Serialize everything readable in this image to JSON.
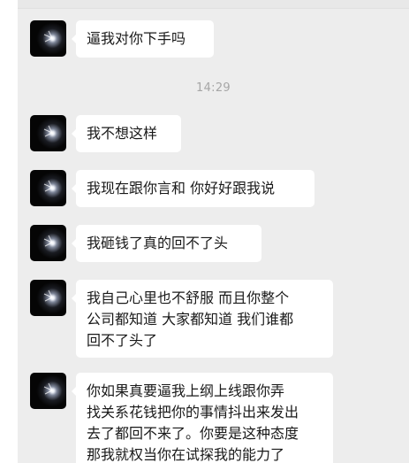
{
  "messages": [
    {
      "id": "m1",
      "lines": [
        "逼我对你下手吗"
      ]
    },
    {
      "id": "m2",
      "lines": [
        "我不想这样"
      ]
    },
    {
      "id": "m3",
      "lines": [
        "我现在跟你言和 你好好跟我说"
      ]
    },
    {
      "id": "m4",
      "lines": [
        "我砸钱了真的回不了头"
      ]
    },
    {
      "id": "m5",
      "lines": [
        "我自己心里也不舒服 而且你整个",
        "公司都知道 大家都知道 我们谁都",
        "回不了头了"
      ]
    },
    {
      "id": "m6",
      "lines": [
        "你如果真要逼我上纲上线跟你弄",
        "找关系花钱把你的事情抖出来发出",
        "去了都回不来了。你要是这种态度",
        " 那我就权当你在试探我的能力了"
      ]
    }
  ],
  "timestamp": "14:29"
}
